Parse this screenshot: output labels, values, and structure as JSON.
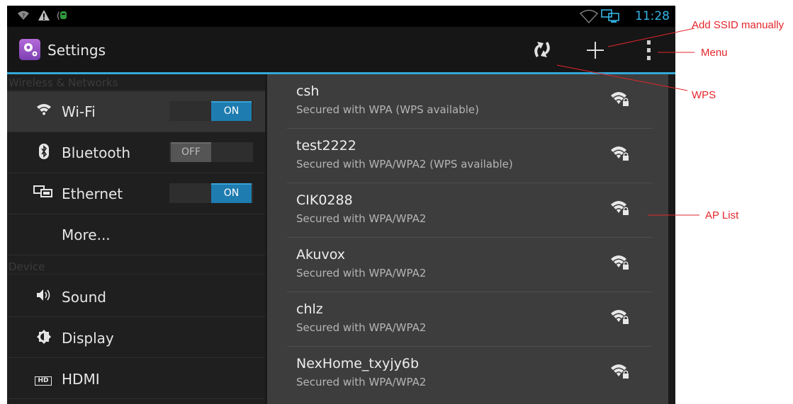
{
  "status_bar": {
    "icons": [
      "wifi-question-icon",
      "warning-icon",
      "usb-debug-icon",
      "wifi-outline-icon",
      "network-monitor-icon"
    ],
    "time": "11:28"
  },
  "action_bar": {
    "app_icon": "settings-gear-icon",
    "title": "Settings",
    "buttons": [
      "wps-icon",
      "add-icon",
      "overflow-menu-icon"
    ]
  },
  "sidebar": {
    "sections": [
      {
        "header": "Wireless & Networks"
      },
      {
        "header": "Device"
      }
    ],
    "items": [
      {
        "icon": "wifi-icon",
        "label": "Wi-Fi",
        "toggle": "ON"
      },
      {
        "icon": "bluetooth-icon",
        "label": "Bluetooth",
        "toggle": "OFF"
      },
      {
        "icon": "ethernet-icon",
        "label": "Ethernet",
        "toggle": "ON"
      },
      {
        "label": "More..."
      },
      {
        "icon": "sound-icon",
        "label": "Sound"
      },
      {
        "icon": "display-icon",
        "label": "Display"
      },
      {
        "icon": "hdmi-icon",
        "label": "HDMI",
        "icon_text": "HD"
      }
    ]
  },
  "ap_list": [
    {
      "ssid": "csh",
      "security": "Secured with WPA (WPS available)"
    },
    {
      "ssid": "test2222",
      "security": "Secured with WPA/WPA2 (WPS available)"
    },
    {
      "ssid": "CIK0288",
      "security": "Secured with WPA/WPA2"
    },
    {
      "ssid": "Akuvox",
      "security": "Secured with WPA/WPA2"
    },
    {
      "ssid": "chlz",
      "security": "Secured with WPA/WPA2"
    },
    {
      "ssid": "NexHome_txyjy6b",
      "security": "Secured with WPA/WPA2"
    }
  ],
  "annotations": {
    "add_ssid": "Add SSID manually",
    "menu": "Menu",
    "wps": "WPS",
    "ap_list": "AP List"
  },
  "colors": {
    "accent": "#33a8d6",
    "toggle_on": "#1e7cb0",
    "annotation": "#e3262b"
  }
}
